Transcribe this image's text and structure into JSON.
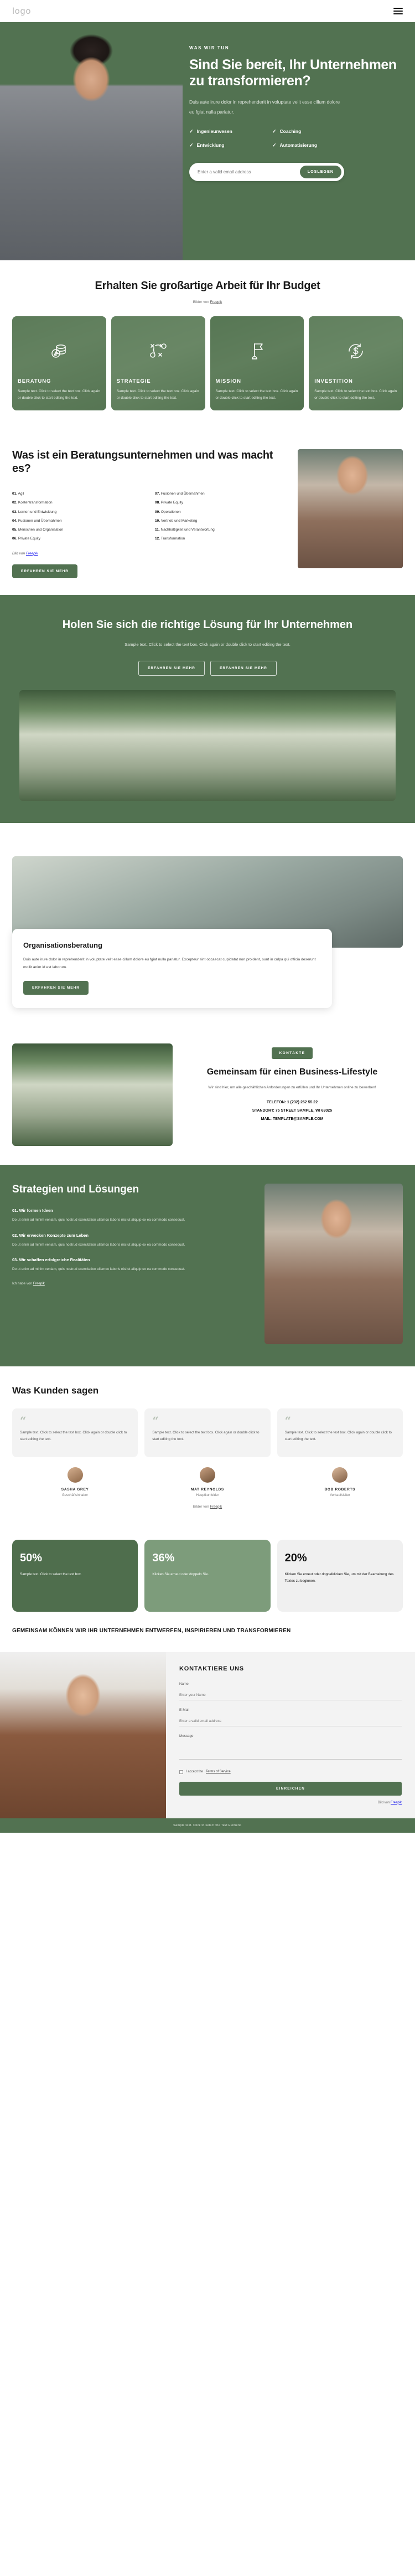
{
  "topbar": {
    "logo": "logo",
    "menu_icon": "hamburger-icon"
  },
  "hero": {
    "eyebrow": "WAS WIR TUN",
    "title": "Sind Sie bereit, Ihr Unternehmen zu transformieren?",
    "paragraph": "Duis aute irure dolor in reprehenderit in voluptate velit esse cillum dolore eu fgiat nulla pariatur.",
    "features": [
      "Ingenieurwesen",
      "Coaching",
      "Entwicklung",
      "Automatisierung"
    ],
    "email_placeholder": "Enter a valid email address",
    "submit_label": "LOSLEGEN"
  },
  "budget": {
    "title": "Erhalten Sie großartige Arbeit für Ihr Budget",
    "credit_prefix": "Bilder von ",
    "credit_link": "Freepik",
    "cards": [
      {
        "title": "BERATUNG",
        "icon": "coins-icon",
        "text": "Sample text. Click to select the text box. Click again or double click to start editing the text."
      },
      {
        "title": "STRATEGIE",
        "icon": "strategy-icon",
        "text": "Sample text. Click to select the text box. Click again or double click to start editing the text."
      },
      {
        "title": "MISSION",
        "icon": "flag-icon",
        "text": "Sample text. Click to select the text box. Click again or double click to start editing the text."
      },
      {
        "title": "INVESTITION",
        "icon": "dollar-refresh-icon",
        "text": "Sample text. Click to select the text box. Click again or double click to start editing the text."
      }
    ]
  },
  "whatis": {
    "title": "Was ist ein Beratungsunternehmen und was macht es?",
    "items_left": [
      {
        "num": "01.",
        "label": "Agil"
      },
      {
        "num": "02.",
        "label": "Kostentransformation"
      },
      {
        "num": "03.",
        "label": "Lernen und Entwicklung"
      },
      {
        "num": "04.",
        "label": "Fusionen und Übernahmen"
      },
      {
        "num": "05.",
        "label": "Menschen und Organisation"
      },
      {
        "num": "06.",
        "label": "Private Equity"
      }
    ],
    "items_right": [
      {
        "num": "07.",
        "label": "Fusionen und Übernahmen"
      },
      {
        "num": "08.",
        "label": "Private Equity"
      },
      {
        "num": "09.",
        "label": "Operationen"
      },
      {
        "num": "10.",
        "label": "Vertrieb und Marketing"
      },
      {
        "num": "11.",
        "label": "Nachhaltigkeit und Verantwortung"
      },
      {
        "num": "12.",
        "label": "Transformation"
      }
    ],
    "credit_prefix": "Bild von ",
    "credit_link": "Freepik",
    "button": "ERFAHREN SIE MEHR"
  },
  "cta": {
    "title": "Holen Sie sich die richtige Lösung für Ihr Unternehmen",
    "paragraph": "Sample text. Click to select the text box. Click again or double click to start editing the text.",
    "button_primary": "ERFAHREN SIE MEHR",
    "button_secondary": "ERFAHREN SIE MEHR"
  },
  "org": {
    "title": "Organisationsberatung",
    "paragraph": "Duis aute irure dolor in reprehenderit in voluptate velit esse cillum dolore eu fgiat nulla pariatur. Excepteur sint occaecat cupidatat non proident, sunt in culpa qui officia deserunt mollit anim id est laborum.",
    "button": "ERFAHREN SIE MEHR"
  },
  "contact": {
    "badge": "KONTAKTE",
    "title": "Gemeinsam für einen Business-Lifestyle",
    "lead": "Wir sind hier, um alle geschäftlichen Anforderungen zu erfüllen und Ihr Unternehmen online zu bewerben!",
    "phone": "TELEFON: 1 (232) 252 55 22",
    "address": "STANDORT: 75 STREET SAMPLE, WI 63025",
    "mail": "MAIL: TEMPLATE@SAMPLE.COM"
  },
  "strategies": {
    "title": "Strategien und Lösungen",
    "steps": [
      {
        "num": "01.",
        "title": "Wir formen Ideen",
        "text": "Do ut enim ad minim veniam, quis nostrud exercitation ullamco laboris nisi ut aliquip ex ea commodo consequat."
      },
      {
        "num": "02.",
        "title": "Wir erwecken Konzepte zum Leben",
        "text": "Do ut enim ad minim veniam, quis nostrud exercitation ullamco laboris nisi ut aliquip ex ea commodo consequat."
      },
      {
        "num": "03.",
        "title": "Wir schaffen erfolgreiche Realitäten",
        "text": "Do ut enim ad minim veniam, quis nostrud exercitation ullamco laboris nisi ut aliquip ex ea commodo consequat."
      }
    ],
    "credit_prefix": "Ich habe von ",
    "credit_link": "Freepik"
  },
  "testimonials": {
    "title": "Was Kunden sagen",
    "cards": [
      {
        "quote_mark": "“",
        "text": "Sample text. Click to select the text box. Click again or double click to start editing the text."
      },
      {
        "quote_mark": "“",
        "text": "Sample text. Click to select the text box. Click again or double click to start editing the text."
      },
      {
        "quote_mark": "“",
        "text": "Sample text. Click to select the text box. Click again or double click to start editing the text."
      }
    ],
    "people": [
      {
        "name": "SASHA GREY",
        "role": "Geschäftsinhaber"
      },
      {
        "name": "MAT REYNOLDS",
        "role": "Hauptkunfelder"
      },
      {
        "name": "BOB ROBERTS",
        "role": "Verkaufsleiter"
      }
    ],
    "credit_prefix": "Bilder von ",
    "credit_link": "Freepik"
  },
  "stats": {
    "items": [
      {
        "value": "50%",
        "text": "Sample text. Click to select the text box."
      },
      {
        "value": "36%",
        "text": "Klicken Sie erneut oder doppeln Sie."
      },
      {
        "value": "20%",
        "text": "Klicken Sie erneut oder doppelklicken Sie, um mit der Bearbeitung des Textes zu beginnen."
      }
    ],
    "tagline": "GEMEINSAM KÖNNEN WIR IHR UNTERNEHMEN ENTWERFEN, INSPIRIEREN UND TRANSFORMIEREN"
  },
  "footer_form": {
    "title": "KONTAKTIERE UNS",
    "name_label": "Name",
    "name_placeholder": "Enter your Name",
    "email_label": "E-Mail",
    "email_placeholder": "Enter a valid email address",
    "message_label": "Message",
    "message_placeholder": "",
    "terms_prefix": "I accept the ",
    "terms_link": "Terms of Service",
    "submit": "EINREICHEN",
    "credit_prefix": "Bild von ",
    "credit_link": "Freepik"
  },
  "bottom_bar": {
    "text": "Sample text. Click to select the Text Element."
  }
}
